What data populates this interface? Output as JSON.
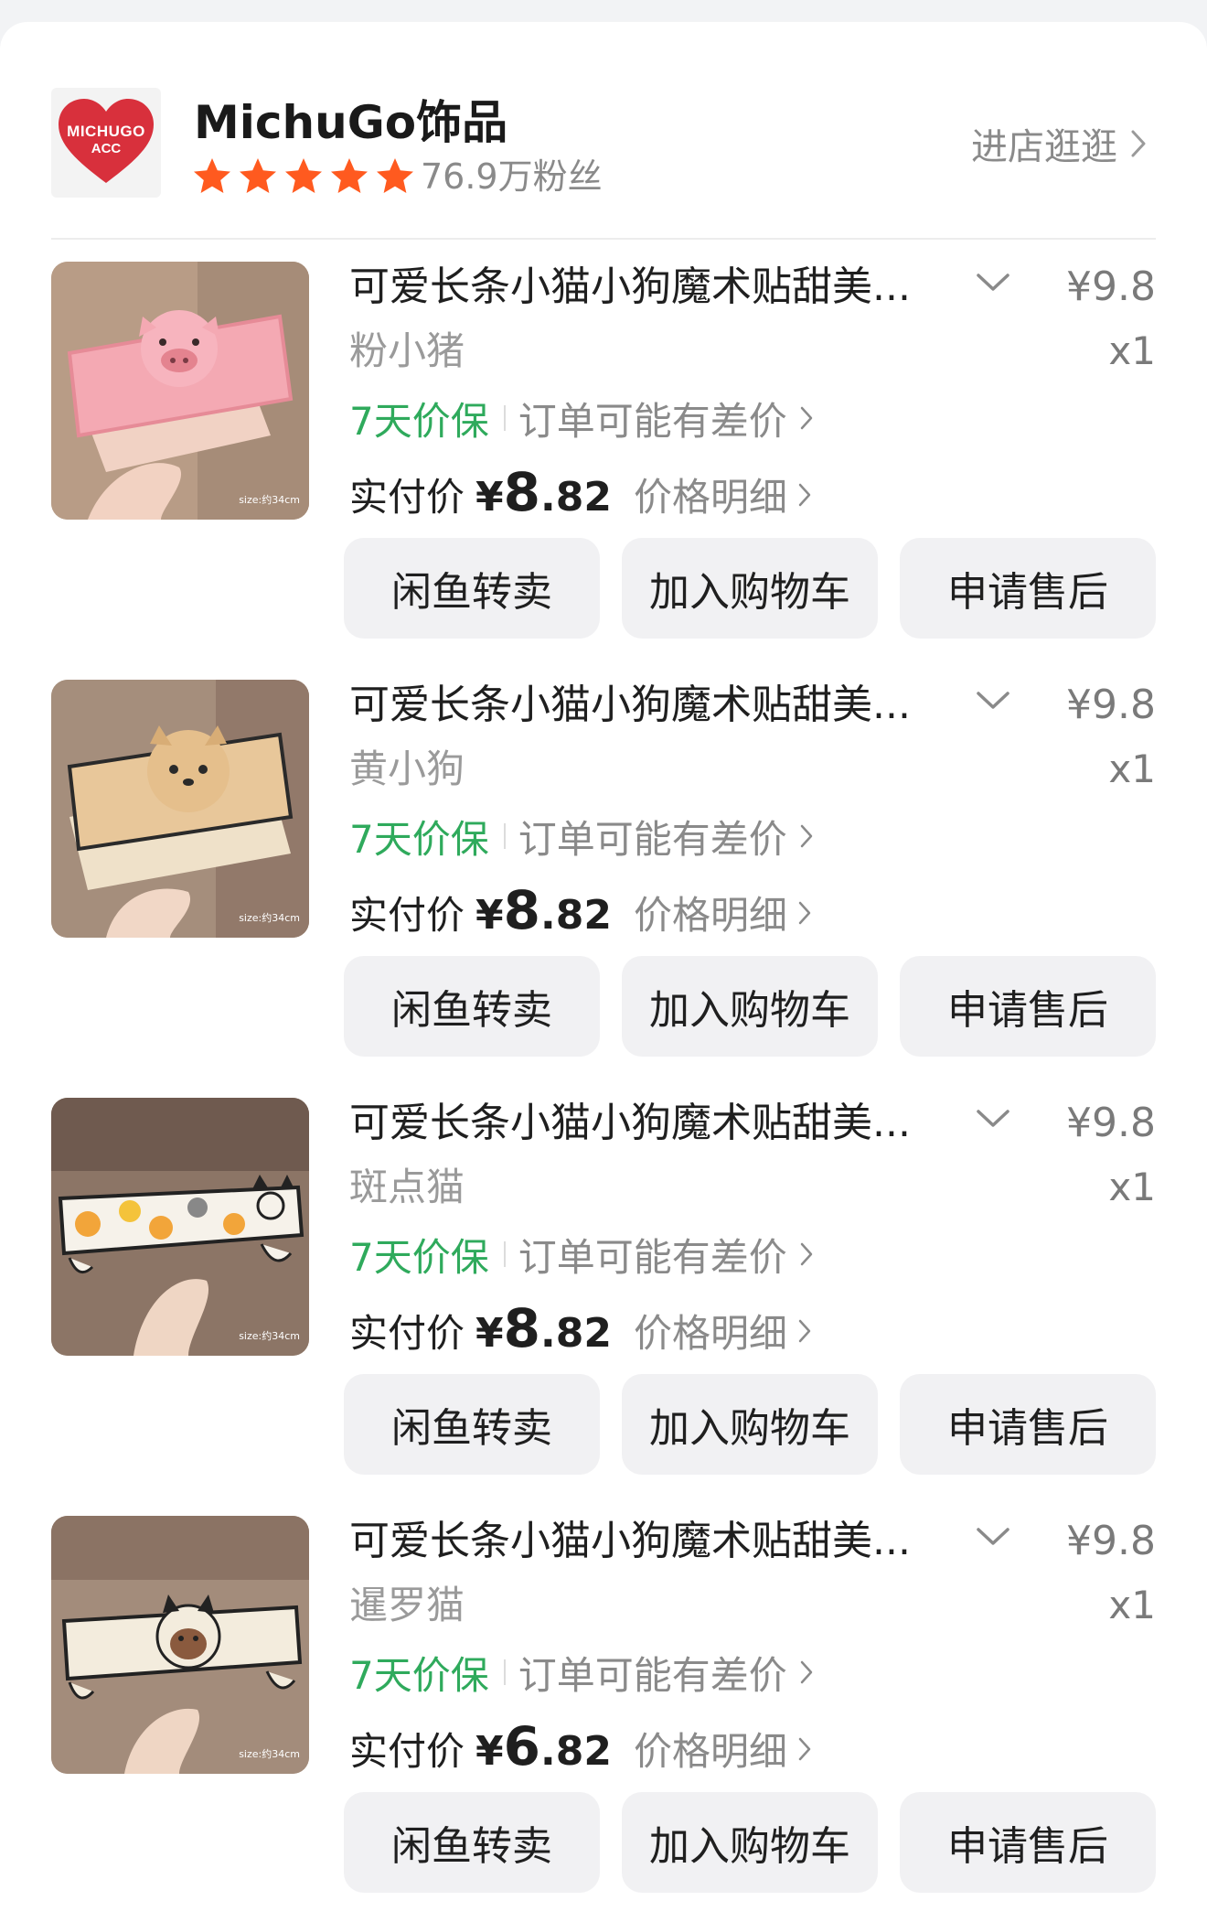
{
  "store": {
    "logo_text_line1": "MICHUGO",
    "logo_text_line2": "ACC",
    "name": "MichuGo饰品",
    "rating_stars": 5,
    "fans": "76.9万粉丝",
    "visit_label": "进店逛逛"
  },
  "colors": {
    "accent_green": "#2faa5c",
    "star_orange": "#ff5a1f",
    "button_bg": "#f1f1f3",
    "logo_red": "#d8303c"
  },
  "icons": {
    "star": "star-icon",
    "chevron_right": "chevron-right-icon",
    "chevron_down": "chevron-down-icon"
  },
  "items": [
    {
      "title": "可爱长条小猫小狗魔术贴甜美...",
      "variant": "粉小猪",
      "price_original": "¥9.8",
      "quantity": "x1",
      "guarantee": "7天价保",
      "price_diff_note": "订单可能有差价",
      "paid_label": "实付价",
      "paid_currency": "¥",
      "paid_int": "8",
      "paid_dec": ".82",
      "detail_label": "价格明细",
      "thumb_caption": "size:约34cm",
      "buttons": [
        "闲鱼转卖",
        "加入购物车",
        "申请售后"
      ]
    },
    {
      "title": "可爱长条小猫小狗魔术贴甜美...",
      "variant": "黄小狗",
      "price_original": "¥9.8",
      "quantity": "x1",
      "guarantee": "7天价保",
      "price_diff_note": "订单可能有差价",
      "paid_label": "实付价",
      "paid_currency": "¥",
      "paid_int": "8",
      "paid_dec": ".82",
      "detail_label": "价格明细",
      "thumb_caption": "size:约34cm",
      "buttons": [
        "闲鱼转卖",
        "加入购物车",
        "申请售后"
      ]
    },
    {
      "title": "可爱长条小猫小狗魔术贴甜美...",
      "variant": "斑点猫",
      "price_original": "¥9.8",
      "quantity": "x1",
      "guarantee": "7天价保",
      "price_diff_note": "订单可能有差价",
      "paid_label": "实付价",
      "paid_currency": "¥",
      "paid_int": "8",
      "paid_dec": ".82",
      "detail_label": "价格明细",
      "thumb_caption": "size:约34cm",
      "buttons": [
        "闲鱼转卖",
        "加入购物车",
        "申请售后"
      ]
    },
    {
      "title": "可爱长条小猫小狗魔术贴甜美...",
      "variant": "暹罗猫",
      "price_original": "¥9.8",
      "quantity": "x1",
      "guarantee": "7天价保",
      "price_diff_note": "订单可能有差价",
      "paid_label": "实付价",
      "paid_currency": "¥",
      "paid_int": "6",
      "paid_dec": ".82",
      "detail_label": "价格明细",
      "thumb_caption": "size:约34cm",
      "buttons": [
        "闲鱼转卖",
        "加入购物车",
        "申请售后"
      ]
    }
  ]
}
